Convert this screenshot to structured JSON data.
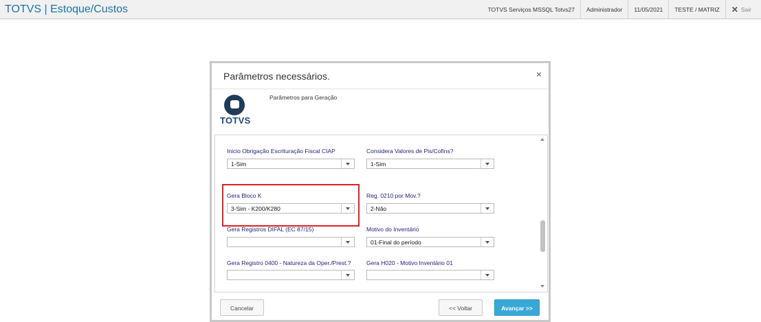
{
  "header": {
    "title": "TOTVS | Estoque/Custos",
    "server": "TOTVS Serviços MSSQL Totvs27",
    "user": "Administrador",
    "date": "11/05/2021",
    "company": "TESTE / MATRIZ",
    "exit_label": "Sair"
  },
  "modal": {
    "title": "Parâmetros necessários.",
    "close_glyph": "×",
    "logo_text": "TOTVS",
    "subtitle": "Parâmetros para Geração",
    "fields": [
      {
        "label": "Inicio Obrigação Escrituração Fiscal CIAP",
        "value": "1-Sim"
      },
      {
        "label": "Considera Valores de Pis/Cofins?",
        "value": "1-Sim"
      },
      {
        "label": "Gera Bloco K",
        "value": "3-Sim - K200/K280"
      },
      {
        "label": "Reg. 0210 por Mov.?",
        "value": "2-Não"
      },
      {
        "label": "Gera Registros DIFAL (EC 87/15)",
        "value": ""
      },
      {
        "label": "Motivo do Inventário",
        "value": "01-Final do período"
      },
      {
        "label": "Gera Registro 0400 - Natureza da Oper./Prest.?",
        "value": ""
      },
      {
        "label": "Gera H020 - Motivo Inventário 01",
        "value": ""
      }
    ],
    "buttons": {
      "cancel": "Cancelar",
      "back": "<< Voltar",
      "next": "Avançar >>"
    }
  },
  "colors": {
    "brand": "#1e73a8",
    "label": "#23237a",
    "highlight": "#e01f26",
    "primary_button": "#3aa8d6"
  },
  "icons": {
    "close": "close-icon",
    "logo": "totvs-logo-icon",
    "dropdown": "chevron-down-icon"
  }
}
